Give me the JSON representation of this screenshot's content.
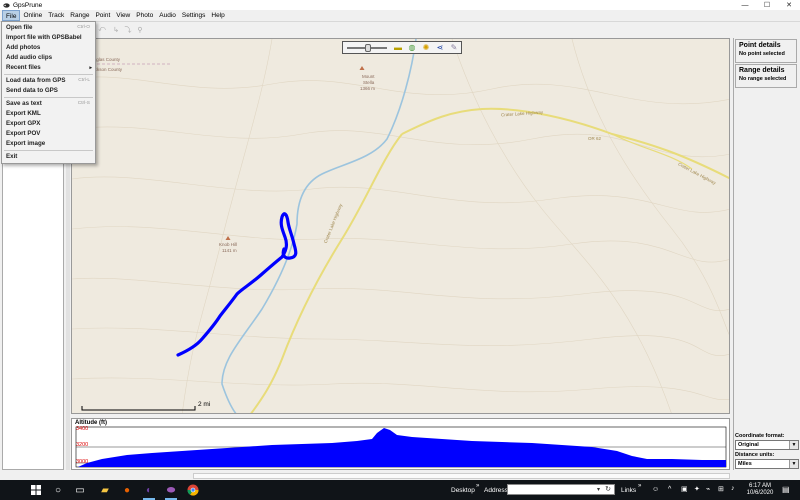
{
  "window": {
    "title": "GpsPrune",
    "minimize": "—",
    "maximize": "☐",
    "close": "✕"
  },
  "menubar": [
    {
      "label": "File",
      "name": "menu-file"
    },
    {
      "label": "Online",
      "name": "menu-online"
    },
    {
      "label": "Track",
      "name": "menu-track"
    },
    {
      "label": "Range",
      "name": "menu-range"
    },
    {
      "label": "Point",
      "name": "menu-point"
    },
    {
      "label": "View",
      "name": "menu-view"
    },
    {
      "label": "Photo",
      "name": "menu-photo"
    },
    {
      "label": "Audio",
      "name": "menu-audio"
    },
    {
      "label": "Settings",
      "name": "menu-settings"
    },
    {
      "label": "Help",
      "name": "menu-help"
    }
  ],
  "file_menu": {
    "groups": [
      [
        {
          "label": "Open file",
          "shortcut": "Ctrl-O"
        },
        {
          "label": "Import file with GPSBabel",
          "shortcut": ""
        },
        {
          "label": "Add photos",
          "shortcut": ""
        },
        {
          "label": "Add audio clips",
          "shortcut": ""
        },
        {
          "label": "Recent files",
          "shortcut": "",
          "submenu": true
        }
      ],
      [
        {
          "label": "Load data from GPS",
          "shortcut": "Ctrl-L"
        },
        {
          "label": "Send data to GPS",
          "shortcut": ""
        }
      ],
      [
        {
          "label": "Save as text",
          "shortcut": "Ctrl-S"
        },
        {
          "label": "Export KML",
          "shortcut": ""
        },
        {
          "label": "Export GPX",
          "shortcut": ""
        },
        {
          "label": "Export POV",
          "shortcut": ""
        },
        {
          "label": "Export image",
          "shortcut": ""
        }
      ],
      [
        {
          "label": "Exit",
          "shortcut": ""
        }
      ]
    ]
  },
  "map": {
    "labels": {
      "county_top": "Douglas County",
      "county_bottom": "Jackson County",
      "peak1_name": "Mount",
      "peak1_name2": "Stella",
      "peak1_elev": "1366 m",
      "peak2_name": "Knob Hill",
      "peak2_elev": "1141 m",
      "hwy1": "Crater Lake Highway",
      "hwy2": "OR 62",
      "hwy3": "Crater Lake Highway",
      "hwy4": "Crater Lake Highway"
    },
    "scale_label": "2 mi",
    "colors": {
      "background": "#efeadf",
      "track": "#0000ff",
      "river": "#9cc4de",
      "road": "#e8dc7a"
    }
  },
  "altitude_profile": {
    "title": "Altitude (ft)",
    "labels": [
      "3400",
      "3200",
      "3000"
    ],
    "fill_color": "#0000ff"
  },
  "right_panel": {
    "point_details_title": "Point details",
    "point_details_value": "No point selected",
    "range_details_title": "Range details",
    "range_details_value": "No range selected",
    "coord_format_label": "Coordinate format:",
    "coord_format_value": "Original",
    "distance_units_label": "Distance units:",
    "distance_units_value": "Miles"
  },
  "taskbar": {
    "desktop_label": "Desktop",
    "address_label": "Address",
    "links_label": "Links",
    "time": "6:17 AM",
    "date": "10/6/2020",
    "icons": [
      "windows-start-icon",
      "search-icon",
      "task-view-icon",
      "file-explorer-icon",
      "firefox-icon",
      "eclipse-icon",
      "gpsprune-icon",
      "chrome-icon"
    ]
  }
}
